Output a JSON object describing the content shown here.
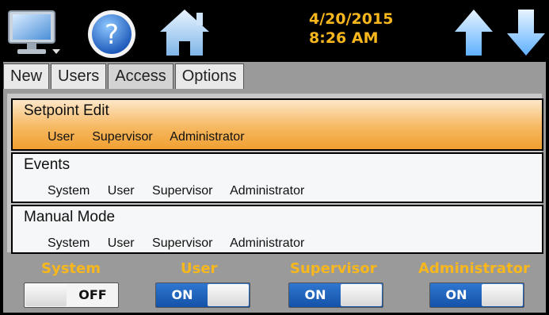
{
  "header": {
    "date": "4/20/2015",
    "time": "8:26 AM",
    "icons": [
      "monitor-icon",
      "help-icon",
      "home-icon",
      "arrow-up-icon",
      "arrow-down-icon"
    ],
    "accent_color": "#F7B71D"
  },
  "tabs": [
    {
      "label": "New",
      "active": false
    },
    {
      "label": "Users",
      "active": false
    },
    {
      "label": "Access",
      "active": true
    },
    {
      "label": "Options",
      "active": false
    }
  ],
  "items": [
    {
      "title": "Setpoint Edit",
      "roles": [
        "User",
        "Supervisor",
        "Administrator"
      ],
      "selected": true
    },
    {
      "title": "Events",
      "roles": [
        "System",
        "User",
        "Supervisor",
        "Administrator"
      ],
      "selected": false
    },
    {
      "title": "Manual Mode",
      "roles": [
        "System",
        "User",
        "Supervisor",
        "Administrator"
      ],
      "selected": false
    }
  ],
  "toggles": [
    {
      "label": "System",
      "state": "OFF"
    },
    {
      "label": "User",
      "state": "ON"
    },
    {
      "label": "Supervisor",
      "state": "ON"
    },
    {
      "label": "Administrator",
      "state": "ON"
    }
  ]
}
